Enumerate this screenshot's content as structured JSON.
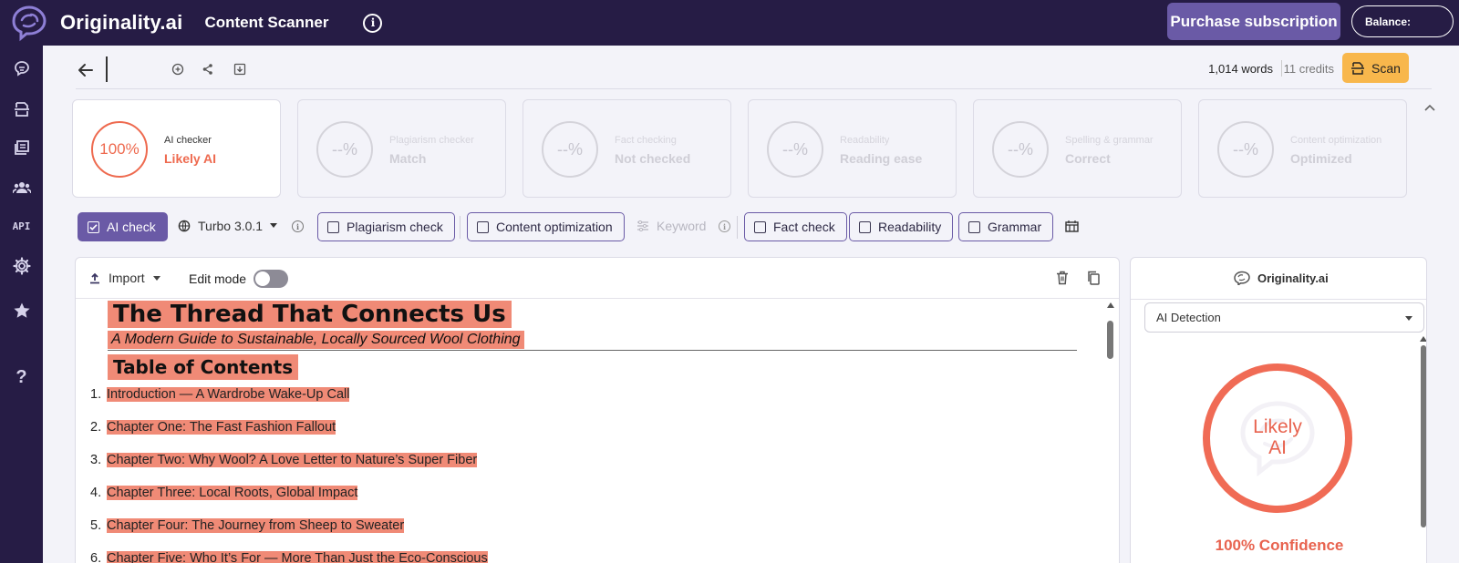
{
  "header": {
    "brand": "Originality.ai",
    "title": "Content Scanner",
    "purchase_label": "Purchase subscription",
    "balance_label": "Balance:"
  },
  "sidebar": {
    "items": [
      {
        "icon": "brain-scan-icon"
      },
      {
        "icon": "scanner-icon"
      },
      {
        "icon": "library-icon"
      },
      {
        "icon": "team-icon"
      },
      {
        "label": "API"
      },
      {
        "icon": "settings-gear-icon"
      },
      {
        "icon": "star-icon"
      },
      {
        "label": "?"
      }
    ]
  },
  "toolbar": {
    "word_count": "1,014 words",
    "credits": "11 credits",
    "scan_label": "Scan"
  },
  "cards": [
    {
      "score": "100%",
      "label": "AI checker",
      "value": "Likely AI"
    },
    {
      "score": "--%",
      "label": "Plagiarism checker",
      "value": "Match"
    },
    {
      "score": "--%",
      "label": "Fact checking",
      "value": "Not checked"
    },
    {
      "score": "--%",
      "label": "Readability",
      "value": "Reading ease"
    },
    {
      "score": "--%",
      "label": "Spelling & grammar",
      "value": "Correct"
    },
    {
      "score": "--%",
      "label": "Content optimization",
      "value": "Optimized"
    }
  ],
  "checks": {
    "ai_check": "AI check",
    "model": "Turbo 3.0.1",
    "plagiarism": "Plagiarism check",
    "content_optimization": "Content optimization",
    "keyword": "Keyword",
    "fact_check": "Fact check",
    "readability": "Readability",
    "grammar": "Grammar"
  },
  "editor": {
    "import_label": "Import",
    "edit_mode_label": "Edit mode",
    "edit_mode_on": false,
    "title": "The Thread That Connects Us",
    "subtitle": "A Modern Guide to Sustainable, Locally Sourced Wool Clothing",
    "toc_heading": "Table of Contents",
    "toc": [
      {
        "num": "1.",
        "text": "Introduction — A Wardrobe Wake-Up Call"
      },
      {
        "num": "2.",
        "text": "Chapter One: The Fast Fashion Fallout"
      },
      {
        "num": "3.",
        "text": "Chapter Two: Why Wool?  A Love Letter to Nature’s Super Fiber"
      },
      {
        "num": "4.",
        "text": "Chapter Three: Local Roots, Global Impact"
      },
      {
        "num": "5.",
        "text": "Chapter Four: The Journey from Sheep to Sweater"
      },
      {
        "num": "6.",
        "text": "Chapter Five: Who It’s For — More Than Just the Eco-Conscious"
      }
    ]
  },
  "result_panel": {
    "brand": "Originality.ai",
    "mode": "AI Detection",
    "verdict_line1": "Likely",
    "verdict_line2": "AI",
    "confidence": "100% Confidence"
  },
  "colors": {
    "nav_bg": "#261c45",
    "accent_purple": "#6a5aa6",
    "ai_red": "#ee6a4f",
    "highlight": "#f08a76",
    "scan_yellow": "#f8b74c"
  }
}
